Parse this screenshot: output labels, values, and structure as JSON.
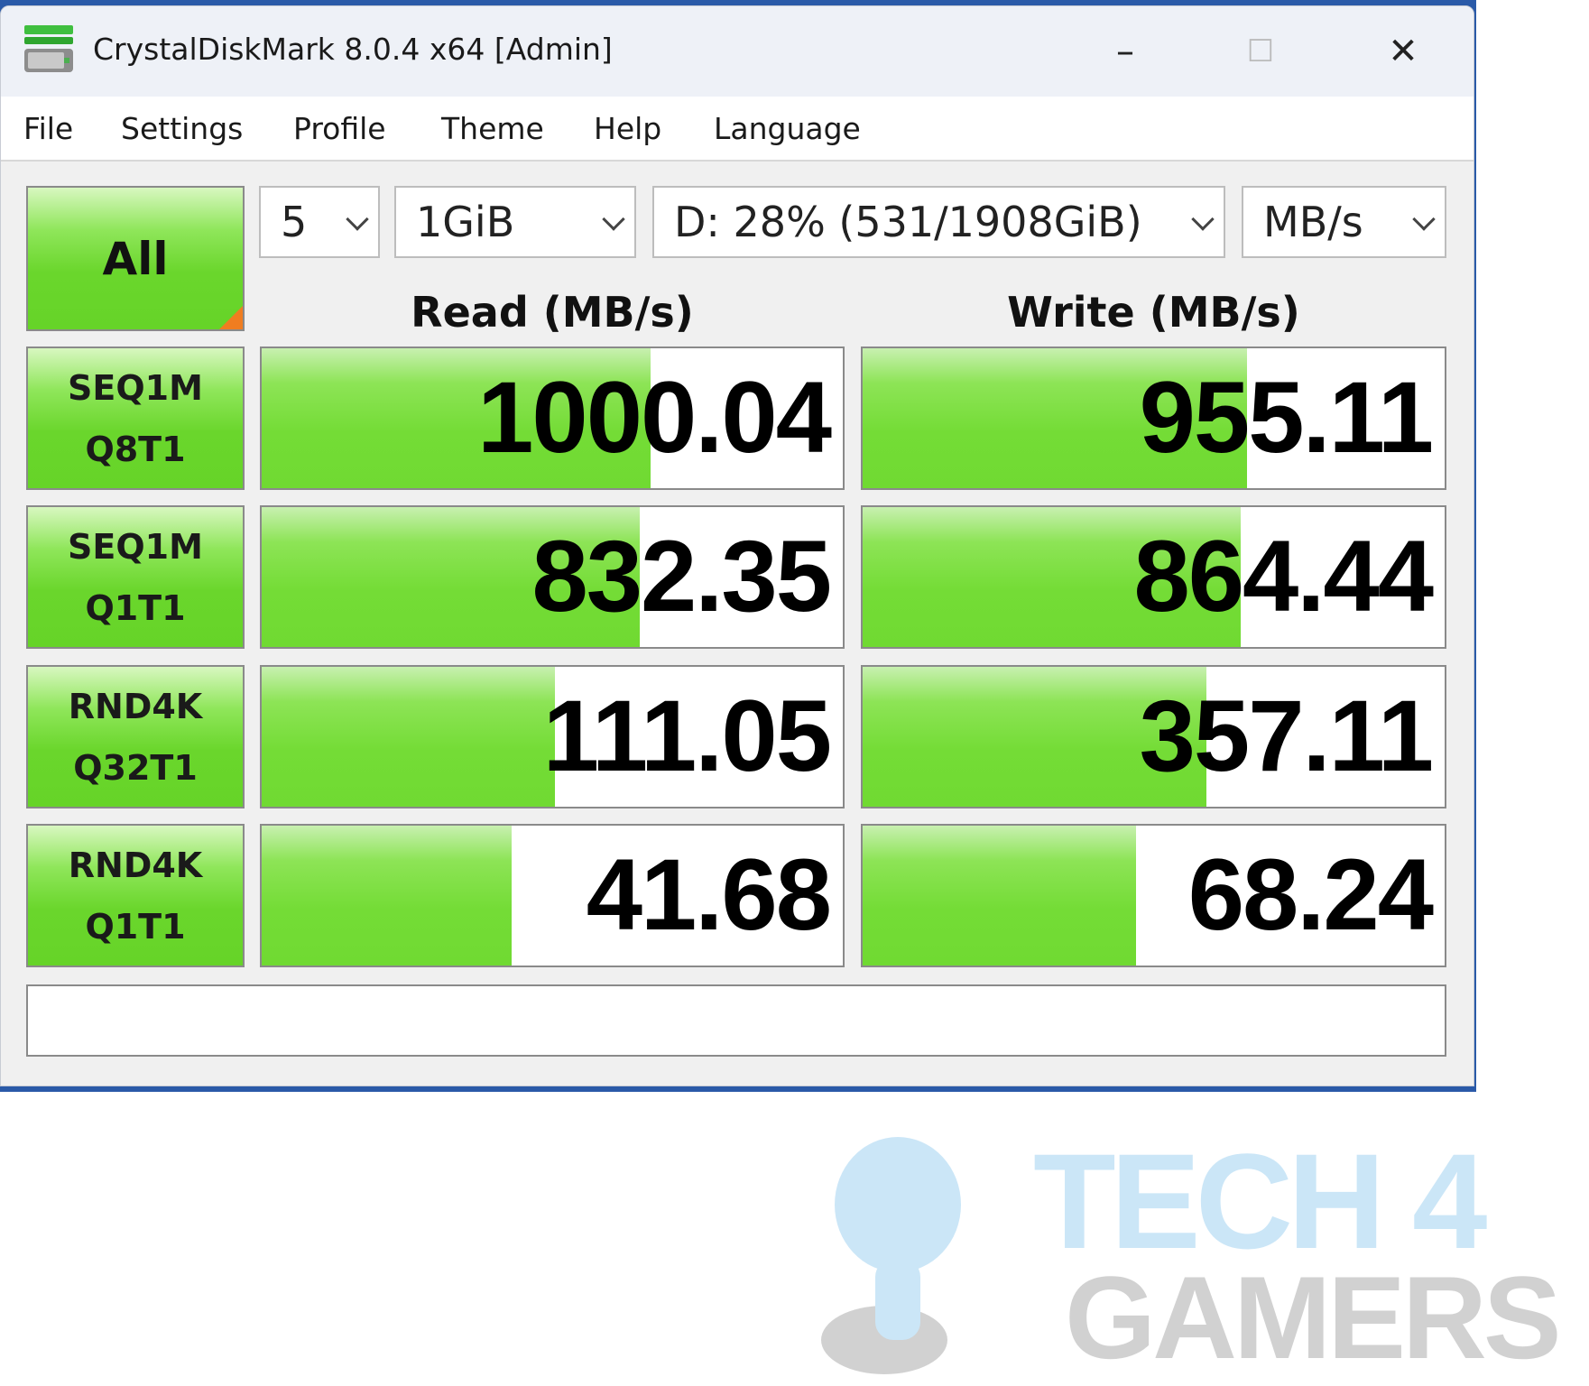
{
  "window": {
    "title": "CrystalDiskMark 8.0.4 x64 [Admin]",
    "minimize": "–",
    "maximize": "☐",
    "close": "✕"
  },
  "menu": [
    "File",
    "Settings",
    "Profile",
    "Theme",
    "Help",
    "Language"
  ],
  "controls": {
    "all_label": "All",
    "count": "5",
    "size": "1GiB",
    "drive": "D: 28% (531/1908GiB)",
    "unit": "MB/s"
  },
  "headers": {
    "read": "Read (MB/s)",
    "write": "Write (MB/s)"
  },
  "results": [
    {
      "test": "SEQ1M",
      "params": "Q8T1",
      "read": "1000.04",
      "write": "955.11",
      "read_bar_fill": 0.67,
      "write_bar_fill": 0.66
    },
    {
      "test": "SEQ1M",
      "params": "Q1T1",
      "read": "832.35",
      "write": "864.44",
      "read_bar_fill": 0.65,
      "write_bar_fill": 0.65
    },
    {
      "test": "RND4K",
      "params": "Q32T1",
      "read": "111.05",
      "write": "357.11",
      "read_bar_fill": 0.505,
      "write_bar_fill": 0.59
    },
    {
      "test": "RND4K",
      "params": "Q1T1",
      "read": "41.68",
      "write": "68.24",
      "read_bar_fill": 0.43,
      "write_bar_fill": 0.47
    }
  ],
  "status": "",
  "watermark": {
    "line1": "TECH 4",
    "line2": "GAMERS"
  },
  "colors": {
    "bar_green": "#70da32",
    "all_corner": "#f07d20"
  }
}
